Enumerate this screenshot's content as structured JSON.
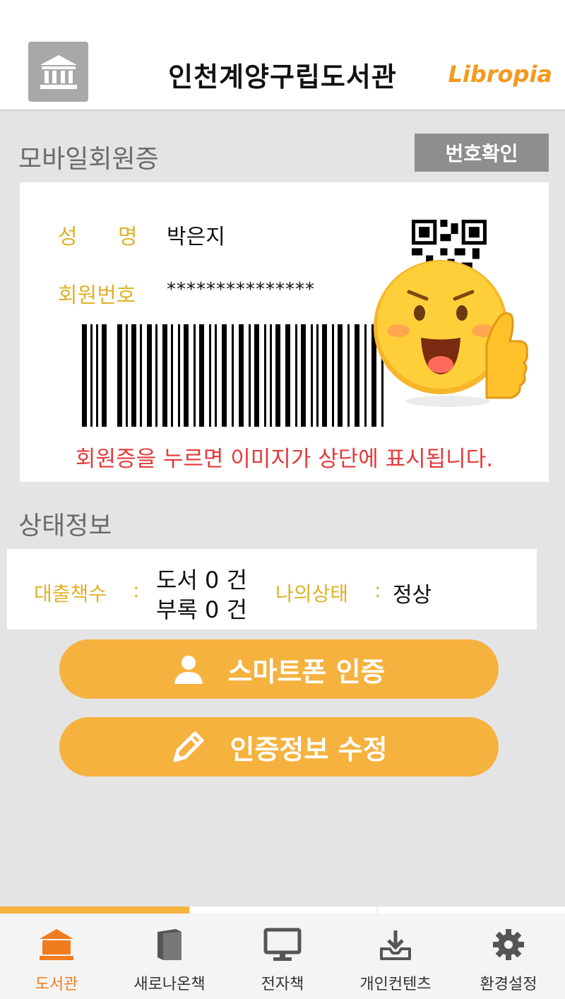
{
  "header": {
    "title": "인천계양구립도서관",
    "brand": "Libropia"
  },
  "member_card": {
    "section_title": "모바일회원증",
    "confirm_button": "번호확인",
    "name_label": "성      명",
    "name_value": "박은지",
    "number_label": "회원번호",
    "number_value": "***************",
    "notice": "회원증을 누르면 이미지가 상단에 표시됩니다."
  },
  "status": {
    "section_title": "상태정보",
    "loan_label": "대출책수",
    "separator": ":",
    "loan_books": "도서 0 건",
    "loan_media": "부록 0 건",
    "state_label": "나의상태",
    "state_value": "정상"
  },
  "actions": {
    "smartphone_auth": "스마트폰 인증",
    "edit_auth": "인증정보 수정"
  },
  "tabs": [
    {
      "label": "도서관",
      "icon": "library-icon",
      "active": true
    },
    {
      "label": "새로나온책",
      "icon": "book-icon",
      "active": false
    },
    {
      "label": "전자책",
      "icon": "monitor-icon",
      "active": false
    },
    {
      "label": "개인컨텐츠",
      "icon": "download-tray-icon",
      "active": false
    },
    {
      "label": "환경설정",
      "icon": "gear-icon",
      "active": false
    }
  ],
  "colors": {
    "accent": "#f5b23f",
    "label_yellow": "#e0b22a",
    "notice_red": "#e33a3a",
    "active_tab": "#f07c1e"
  }
}
